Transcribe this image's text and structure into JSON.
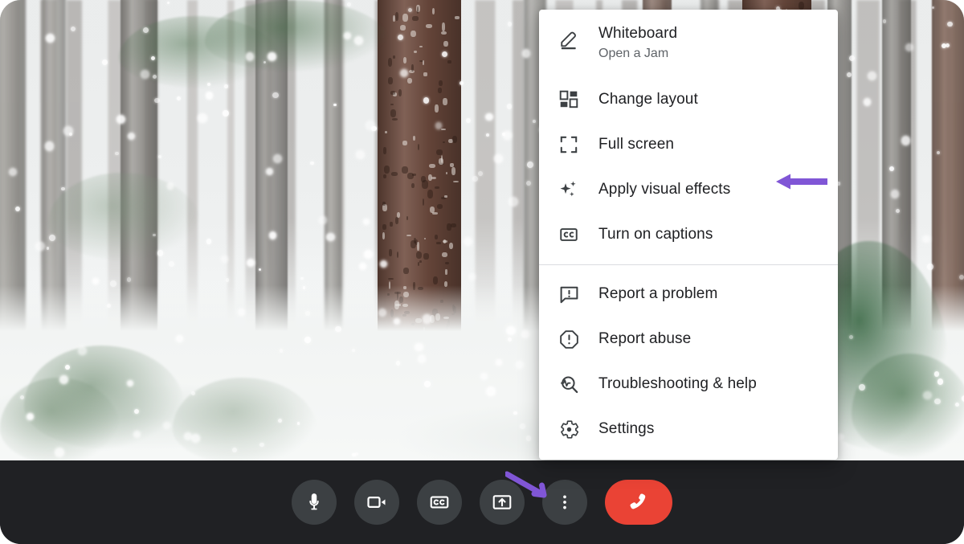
{
  "app": {
    "name": "video-call-app",
    "background_description": "Snowy pine forest virtual background"
  },
  "menu": {
    "name": "more-options-menu",
    "groups": [
      {
        "items": [
          {
            "id": "whiteboard",
            "label": "Whiteboard",
            "sublabel": "Open a Jam",
            "icon": "pencil-icon"
          },
          {
            "id": "change-layout",
            "label": "Change layout",
            "sublabel": "",
            "icon": "layout-icon"
          },
          {
            "id": "full-screen",
            "label": "Full screen",
            "sublabel": "",
            "icon": "fullscreen-icon"
          },
          {
            "id": "visual-effects",
            "label": "Apply visual effects",
            "sublabel": "",
            "icon": "sparkle-icon"
          },
          {
            "id": "captions",
            "label": "Turn on captions",
            "sublabel": "",
            "icon": "closed-caption-icon"
          }
        ]
      },
      {
        "items": [
          {
            "id": "report-problem",
            "label": "Report a problem",
            "sublabel": "",
            "icon": "speech-bubble-alert-icon"
          },
          {
            "id": "report-abuse",
            "label": "Report abuse",
            "sublabel": "",
            "icon": "octagon-alert-icon"
          },
          {
            "id": "troubleshooting",
            "label": "Troubleshooting & help",
            "sublabel": "",
            "icon": "magnifier-pulse-icon"
          },
          {
            "id": "settings",
            "label": "Settings",
            "sublabel": "",
            "icon": "gear-icon"
          }
        ]
      }
    ]
  },
  "toolbar": {
    "name": "call-control-bar",
    "background_color": "#202124",
    "button_color": "#3c4043",
    "hangup_color": "#ea4335",
    "buttons": [
      {
        "id": "microphone",
        "label": "Microphone",
        "icon": "microphone-icon"
      },
      {
        "id": "camera",
        "label": "Camera",
        "icon": "video-camera-icon"
      },
      {
        "id": "captions",
        "label": "Captions",
        "icon": "closed-caption-icon"
      },
      {
        "id": "present",
        "label": "Present now",
        "icon": "present-screen-icon"
      },
      {
        "id": "more-options",
        "label": "More options",
        "icon": "three-dots-vertical-icon"
      },
      {
        "id": "leave-call",
        "label": "Leave call",
        "icon": "hangup-phone-icon"
      }
    ]
  },
  "annotations": {
    "color": "#8056d6",
    "arrows": [
      {
        "id": "arrow-to-visual-effects",
        "points_to": "Apply visual effects",
        "direction": "left"
      },
      {
        "id": "arrow-to-more-options",
        "points_to": "More options",
        "direction": "down-right"
      }
    ]
  }
}
